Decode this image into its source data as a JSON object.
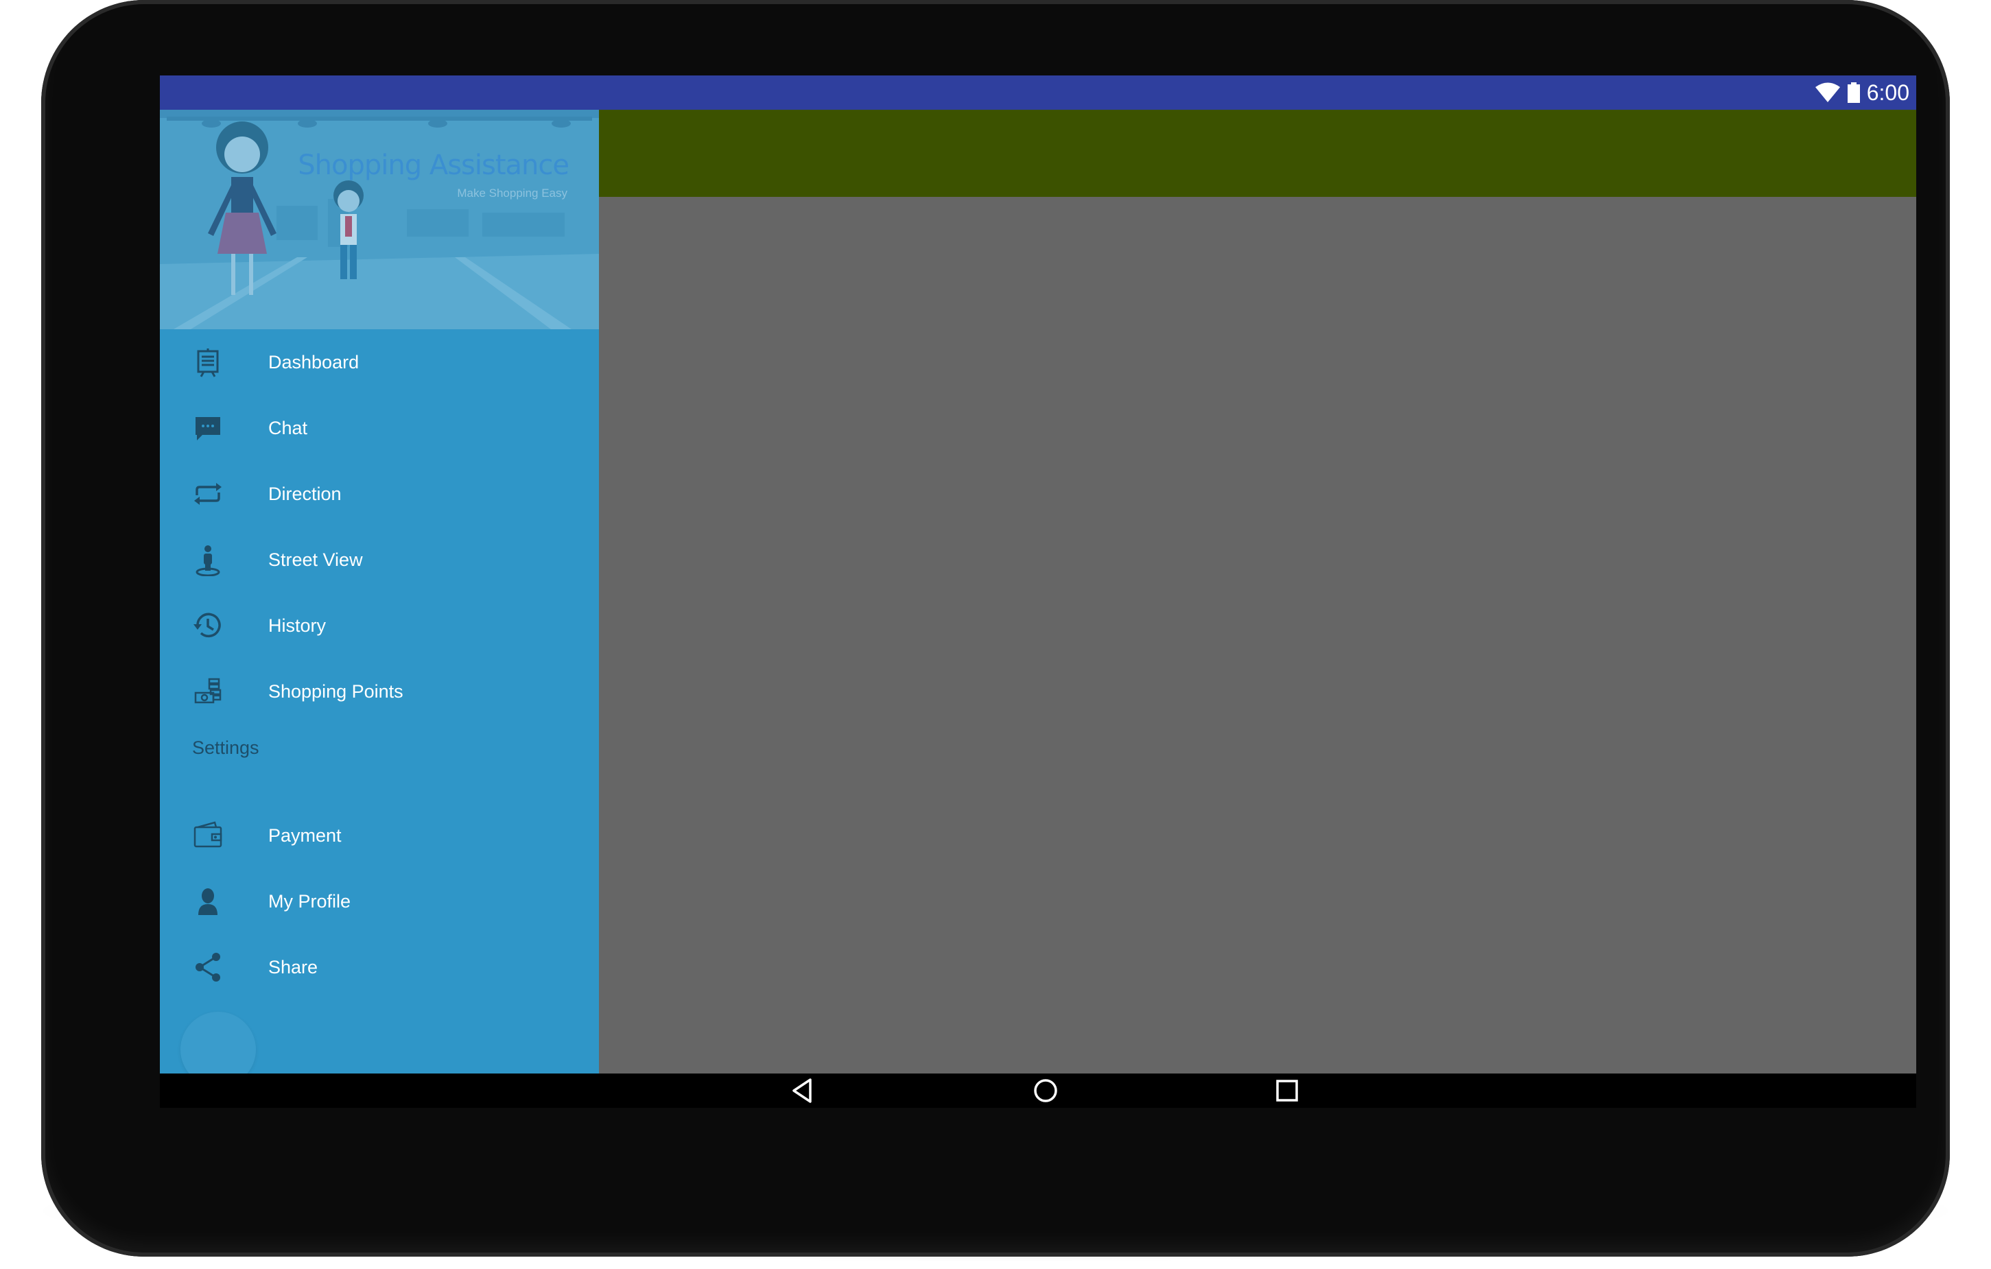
{
  "status_bar": {
    "time": "6:00",
    "icons": [
      "wifi-icon",
      "battery-icon"
    ]
  },
  "drawer": {
    "header": {
      "title": "Shopping Assistance",
      "subtitle": "Make Shopping Easy"
    },
    "items": [
      {
        "label": "Dashboard",
        "icon": "dashboard-icon"
      },
      {
        "label": "Chat",
        "icon": "chat-icon"
      },
      {
        "label": "Direction",
        "icon": "direction-icon"
      },
      {
        "label": "Street View",
        "icon": "street-view-icon"
      },
      {
        "label": "History",
        "icon": "history-icon"
      },
      {
        "label": "Shopping Points",
        "icon": "shopping-points-icon"
      }
    ],
    "settings_section": {
      "title": "Settings",
      "items": [
        {
          "label": "Payment",
          "icon": "wallet-icon"
        },
        {
          "label": "My Profile",
          "icon": "person-icon"
        },
        {
          "label": "Share",
          "icon": "share-icon"
        }
      ]
    }
  },
  "colors": {
    "status_bar": "#2f3f9e",
    "drawer_bg": "#2f96c8",
    "appbar": "#3c5200",
    "scrim_content": "#666666",
    "menu_text": "#ffffff",
    "icon_color": "#1d4e6a"
  },
  "nav_bar": {
    "buttons": [
      "back-icon",
      "home-icon",
      "recents-icon"
    ]
  }
}
